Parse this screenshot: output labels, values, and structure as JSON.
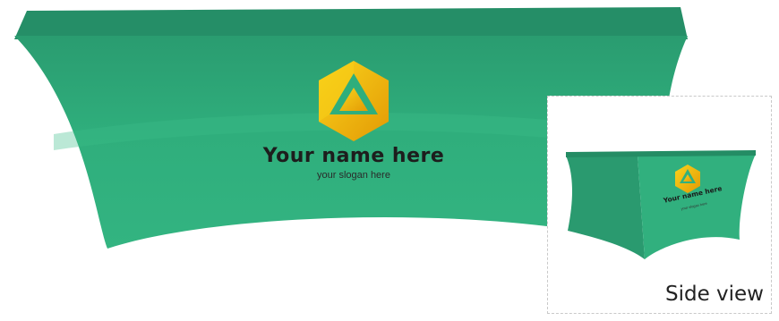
{
  "main_cover": {
    "name": "Your name here",
    "slogan": "your slogan here"
  },
  "side_view": {
    "caption": "Side view",
    "name": "Your name here",
    "slogan": "your slogan here"
  },
  "colors": {
    "cover_green": "#2fae7c",
    "cover_green_dark": "#248f65",
    "logo_gold": "#f2c20b",
    "logo_orange": "#e8a20a"
  },
  "icons": [
    "hexagon-triangle-logo-icon"
  ]
}
